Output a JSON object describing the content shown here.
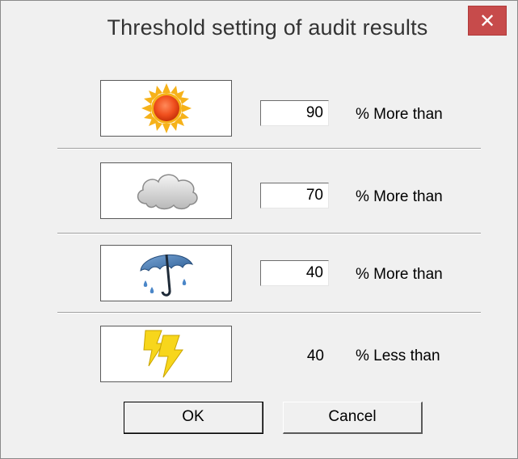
{
  "window": {
    "title": "Threshold setting of audit results",
    "close_glyph": "✕"
  },
  "rows": [
    {
      "icon": "sun-icon",
      "value": "90",
      "condition": "% More than",
      "editable": true
    },
    {
      "icon": "cloud-icon",
      "value": "70",
      "condition": "% More than",
      "editable": true
    },
    {
      "icon": "umbrella-rain-icon",
      "value": "40",
      "condition": "% More than",
      "editable": true
    },
    {
      "icon": "lightning-icon",
      "value": "40",
      "condition": "% Less than",
      "editable": false
    }
  ],
  "buttons": {
    "ok": "OK",
    "cancel": "Cancel"
  },
  "colors": {
    "close_button": "#c74b4b",
    "dialog_background": "#f0f0f0"
  }
}
